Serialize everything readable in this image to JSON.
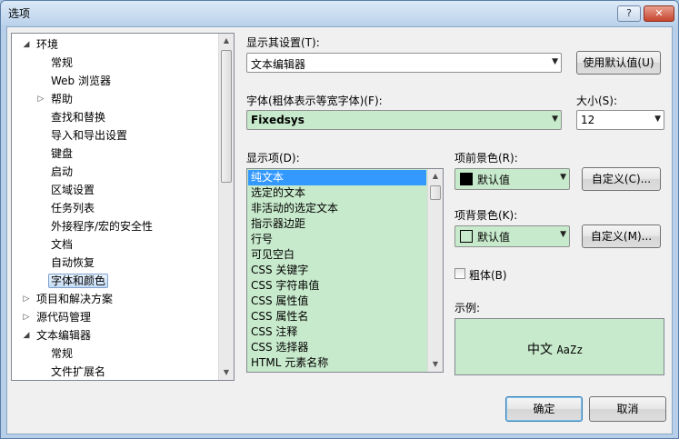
{
  "window": {
    "title": "选项",
    "help_label": "?",
    "close_label": "✕"
  },
  "tree": {
    "items": [
      {
        "label": "环境",
        "state": "expanded"
      },
      {
        "label": "常规"
      },
      {
        "label": "Web 浏览器"
      },
      {
        "label": "帮助",
        "state": "collapsed"
      },
      {
        "label": "查找和替换"
      },
      {
        "label": "导入和导出设置"
      },
      {
        "label": "键盘"
      },
      {
        "label": "启动"
      },
      {
        "label": "区域设置"
      },
      {
        "label": "任务列表"
      },
      {
        "label": "外接程序/宏的安全性"
      },
      {
        "label": "文档"
      },
      {
        "label": "自动恢复"
      },
      {
        "label": "字体和颜色",
        "selected": true
      },
      {
        "label": "项目和解决方案",
        "state": "collapsed"
      },
      {
        "label": "源代码管理",
        "state": "collapsed"
      },
      {
        "label": "文本编辑器",
        "state": "expanded"
      },
      {
        "label": "常规"
      },
      {
        "label": "文件扩展名"
      }
    ]
  },
  "settings": {
    "show_settings_label": "显示其设置(T):",
    "show_settings_value": "文本编辑器",
    "use_defaults_button": "使用默认值(U)",
    "font_label": "字体(粗体表示等宽字体)(F):",
    "font_value": "Fixedsys",
    "size_label": "大小(S):",
    "size_value": "12",
    "display_items_label": "显示项(D):",
    "display_items": [
      "纯文本",
      "选定的文本",
      "非活动的选定文本",
      "指示器边距",
      "行号",
      "可见空白",
      "CSS 关键字",
      "CSS 字符串值",
      "CSS 属性值",
      "CSS 属性名",
      "CSS 注释",
      "CSS 选择器",
      "HTML 元素名称"
    ],
    "selected_display_item": "纯文本",
    "foreground_label": "项前景色(R):",
    "foreground_value": "默认值",
    "foreground_color": "#000000",
    "foreground_custom_button": "自定义(C)...",
    "background_label": "项背景色(K):",
    "background_value": "默认值",
    "background_color": "#c8eacc",
    "background_custom_button": "自定义(M)...",
    "bold_label": "粗体(B)",
    "bold_checked": false,
    "sample_label": "示例:",
    "sample_text_cjk": "中文",
    "sample_text_latin": "AaZz"
  },
  "footer": {
    "ok_button": "确定",
    "cancel_button": "取消"
  },
  "colors": {
    "item_background": "#c8eacc",
    "selection": "#3399ff"
  }
}
